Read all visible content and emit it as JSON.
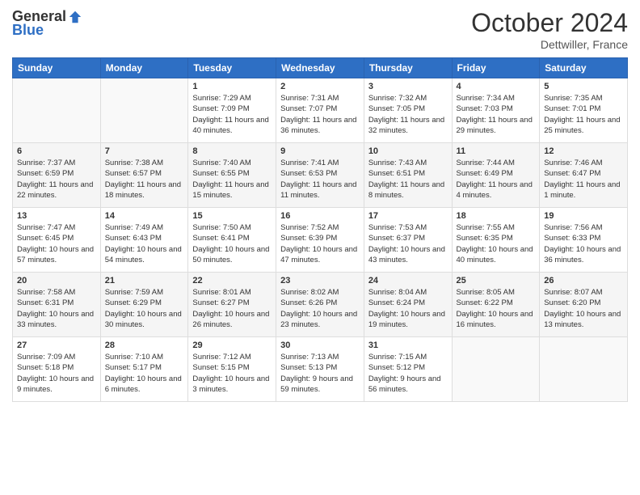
{
  "header": {
    "logo_general": "General",
    "logo_blue": "Blue",
    "month": "October 2024",
    "location": "Dettwiller, France"
  },
  "days_of_week": [
    "Sunday",
    "Monday",
    "Tuesday",
    "Wednesday",
    "Thursday",
    "Friday",
    "Saturday"
  ],
  "weeks": [
    [
      {
        "day": "",
        "empty": true
      },
      {
        "day": "",
        "empty": true
      },
      {
        "day": "1",
        "sunrise": "Sunrise: 7:29 AM",
        "sunset": "Sunset: 7:09 PM",
        "daylight": "Daylight: 11 hours and 40 minutes."
      },
      {
        "day": "2",
        "sunrise": "Sunrise: 7:31 AM",
        "sunset": "Sunset: 7:07 PM",
        "daylight": "Daylight: 11 hours and 36 minutes."
      },
      {
        "day": "3",
        "sunrise": "Sunrise: 7:32 AM",
        "sunset": "Sunset: 7:05 PM",
        "daylight": "Daylight: 11 hours and 32 minutes."
      },
      {
        "day": "4",
        "sunrise": "Sunrise: 7:34 AM",
        "sunset": "Sunset: 7:03 PM",
        "daylight": "Daylight: 11 hours and 29 minutes."
      },
      {
        "day": "5",
        "sunrise": "Sunrise: 7:35 AM",
        "sunset": "Sunset: 7:01 PM",
        "daylight": "Daylight: 11 hours and 25 minutes."
      }
    ],
    [
      {
        "day": "6",
        "sunrise": "Sunrise: 7:37 AM",
        "sunset": "Sunset: 6:59 PM",
        "daylight": "Daylight: 11 hours and 22 minutes."
      },
      {
        "day": "7",
        "sunrise": "Sunrise: 7:38 AM",
        "sunset": "Sunset: 6:57 PM",
        "daylight": "Daylight: 11 hours and 18 minutes."
      },
      {
        "day": "8",
        "sunrise": "Sunrise: 7:40 AM",
        "sunset": "Sunset: 6:55 PM",
        "daylight": "Daylight: 11 hours and 15 minutes."
      },
      {
        "day": "9",
        "sunrise": "Sunrise: 7:41 AM",
        "sunset": "Sunset: 6:53 PM",
        "daylight": "Daylight: 11 hours and 11 minutes."
      },
      {
        "day": "10",
        "sunrise": "Sunrise: 7:43 AM",
        "sunset": "Sunset: 6:51 PM",
        "daylight": "Daylight: 11 hours and 8 minutes."
      },
      {
        "day": "11",
        "sunrise": "Sunrise: 7:44 AM",
        "sunset": "Sunset: 6:49 PM",
        "daylight": "Daylight: 11 hours and 4 minutes."
      },
      {
        "day": "12",
        "sunrise": "Sunrise: 7:46 AM",
        "sunset": "Sunset: 6:47 PM",
        "daylight": "Daylight: 11 hours and 1 minute."
      }
    ],
    [
      {
        "day": "13",
        "sunrise": "Sunrise: 7:47 AM",
        "sunset": "Sunset: 6:45 PM",
        "daylight": "Daylight: 10 hours and 57 minutes."
      },
      {
        "day": "14",
        "sunrise": "Sunrise: 7:49 AM",
        "sunset": "Sunset: 6:43 PM",
        "daylight": "Daylight: 10 hours and 54 minutes."
      },
      {
        "day": "15",
        "sunrise": "Sunrise: 7:50 AM",
        "sunset": "Sunset: 6:41 PM",
        "daylight": "Daylight: 10 hours and 50 minutes."
      },
      {
        "day": "16",
        "sunrise": "Sunrise: 7:52 AM",
        "sunset": "Sunset: 6:39 PM",
        "daylight": "Daylight: 10 hours and 47 minutes."
      },
      {
        "day": "17",
        "sunrise": "Sunrise: 7:53 AM",
        "sunset": "Sunset: 6:37 PM",
        "daylight": "Daylight: 10 hours and 43 minutes."
      },
      {
        "day": "18",
        "sunrise": "Sunrise: 7:55 AM",
        "sunset": "Sunset: 6:35 PM",
        "daylight": "Daylight: 10 hours and 40 minutes."
      },
      {
        "day": "19",
        "sunrise": "Sunrise: 7:56 AM",
        "sunset": "Sunset: 6:33 PM",
        "daylight": "Daylight: 10 hours and 36 minutes."
      }
    ],
    [
      {
        "day": "20",
        "sunrise": "Sunrise: 7:58 AM",
        "sunset": "Sunset: 6:31 PM",
        "daylight": "Daylight: 10 hours and 33 minutes."
      },
      {
        "day": "21",
        "sunrise": "Sunrise: 7:59 AM",
        "sunset": "Sunset: 6:29 PM",
        "daylight": "Daylight: 10 hours and 30 minutes."
      },
      {
        "day": "22",
        "sunrise": "Sunrise: 8:01 AM",
        "sunset": "Sunset: 6:27 PM",
        "daylight": "Daylight: 10 hours and 26 minutes."
      },
      {
        "day": "23",
        "sunrise": "Sunrise: 8:02 AM",
        "sunset": "Sunset: 6:26 PM",
        "daylight": "Daylight: 10 hours and 23 minutes."
      },
      {
        "day": "24",
        "sunrise": "Sunrise: 8:04 AM",
        "sunset": "Sunset: 6:24 PM",
        "daylight": "Daylight: 10 hours and 19 minutes."
      },
      {
        "day": "25",
        "sunrise": "Sunrise: 8:05 AM",
        "sunset": "Sunset: 6:22 PM",
        "daylight": "Daylight: 10 hours and 16 minutes."
      },
      {
        "day": "26",
        "sunrise": "Sunrise: 8:07 AM",
        "sunset": "Sunset: 6:20 PM",
        "daylight": "Daylight: 10 hours and 13 minutes."
      }
    ],
    [
      {
        "day": "27",
        "sunrise": "Sunrise: 7:09 AM",
        "sunset": "Sunset: 5:18 PM",
        "daylight": "Daylight: 10 hours and 9 minutes."
      },
      {
        "day": "28",
        "sunrise": "Sunrise: 7:10 AM",
        "sunset": "Sunset: 5:17 PM",
        "daylight": "Daylight: 10 hours and 6 minutes."
      },
      {
        "day": "29",
        "sunrise": "Sunrise: 7:12 AM",
        "sunset": "Sunset: 5:15 PM",
        "daylight": "Daylight: 10 hours and 3 minutes."
      },
      {
        "day": "30",
        "sunrise": "Sunrise: 7:13 AM",
        "sunset": "Sunset: 5:13 PM",
        "daylight": "Daylight: 9 hours and 59 minutes."
      },
      {
        "day": "31",
        "sunrise": "Sunrise: 7:15 AM",
        "sunset": "Sunset: 5:12 PM",
        "daylight": "Daylight: 9 hours and 56 minutes."
      },
      {
        "day": "",
        "empty": true
      },
      {
        "day": "",
        "empty": true
      }
    ]
  ]
}
